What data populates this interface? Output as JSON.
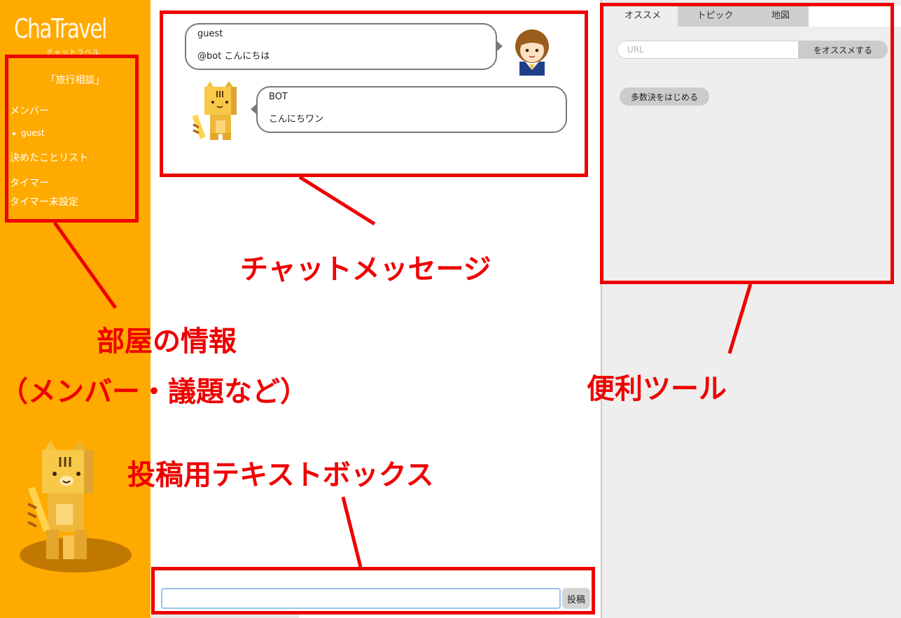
{
  "sidebar": {
    "logo": "ChaTravel",
    "logo_sub": "チャットラベル",
    "room_title": "「旅行相談」",
    "members_heading": "メンバー",
    "members": [
      "guest"
    ],
    "decided_heading": "決めたことリスト",
    "timer_heading": "タイマー",
    "timer_status": "タイマー未設定"
  },
  "chat": {
    "messages": [
      {
        "name": "guest",
        "text": "@bot こんにちは"
      },
      {
        "name": "BOT",
        "text": "こんにちワン"
      }
    ]
  },
  "composer": {
    "input_value": "",
    "post_label": "投稿"
  },
  "tools": {
    "tabs": [
      "オススメ",
      "トピック",
      "地図"
    ],
    "url_placeholder": "URL",
    "recommend_label": "をオススメする",
    "vote_label": "多数決をはじめる"
  },
  "annotations": {
    "chat_label": "チャットメッセージ",
    "room_label_1": "部屋の情報",
    "room_label_2": "（メンバー・議題など）",
    "tools_label": "便利ツール",
    "post_label": "投稿用テキストボックス"
  },
  "colors": {
    "sidebar": "#ffaa00",
    "annotation": "#ee0000",
    "panel": "#eeeeee"
  }
}
